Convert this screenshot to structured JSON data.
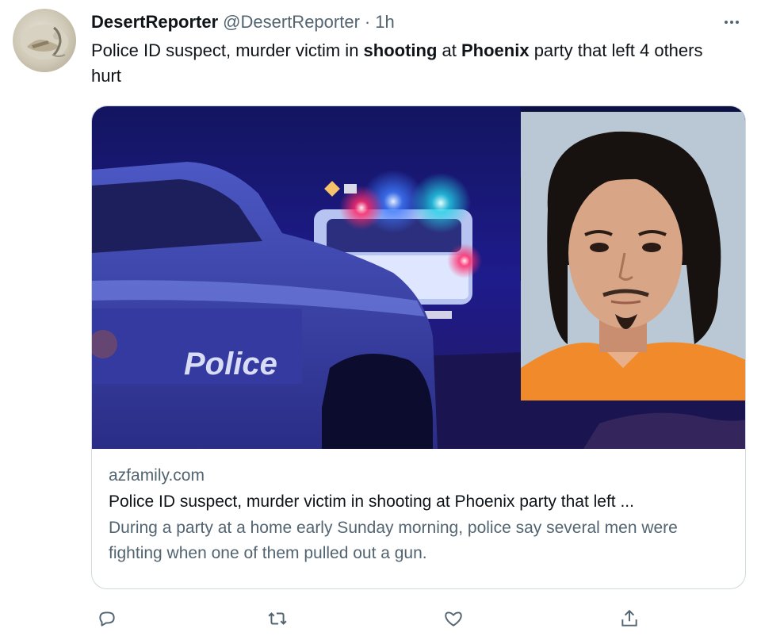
{
  "tweet": {
    "author_name": "DesertReporter",
    "author_handle": "@DesertReporter",
    "separator": "·",
    "time": "1h",
    "text_parts": [
      {
        "text": "Police ID suspect, murder victim in ",
        "bold": false
      },
      {
        "text": "shooting",
        "bold": true
      },
      {
        "text": " at ",
        "bold": false
      },
      {
        "text": "Phoenix",
        "bold": true
      },
      {
        "text": " party that left 4 others hurt",
        "bold": false
      }
    ]
  },
  "card": {
    "image_police_text": "Police",
    "image_car_text": "olice",
    "domain": "azfamily.com",
    "title": "Police ID suspect, murder victim in shooting at Phoenix party that left ...",
    "description": "During a party at a home early Sunday morning, police say several men were fighting when one of them pulled out a gun."
  },
  "icons": {
    "more": "more-icon",
    "reply": "reply-icon",
    "retweet": "retweet-icon",
    "like": "like-icon",
    "share": "share-icon"
  },
  "colors": {
    "text_primary": "#0f1419",
    "text_secondary": "#536471",
    "border": "#cfd9de",
    "mugshot_background": "#b9c8d4",
    "jumpsuit": "#f08a2a"
  }
}
